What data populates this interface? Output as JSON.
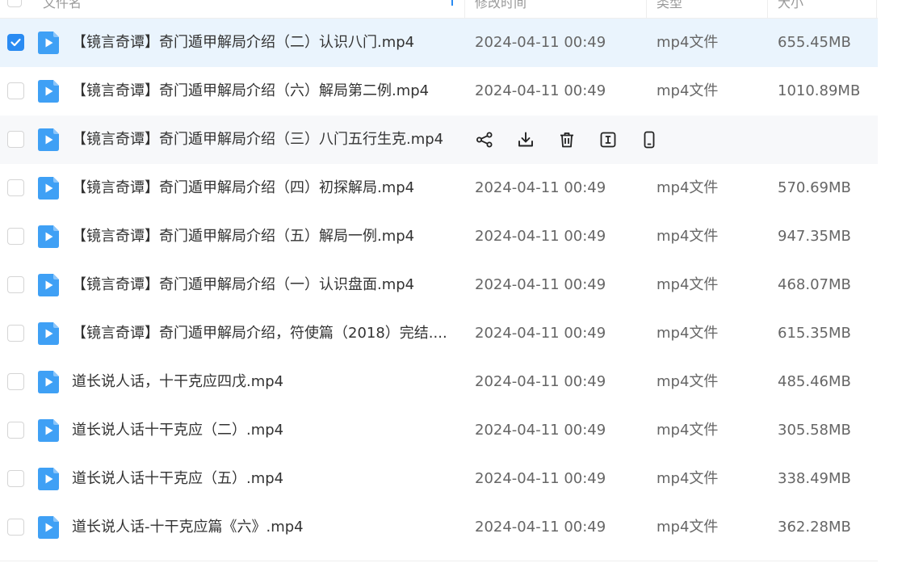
{
  "header": {
    "name": "文件名",
    "modified": "修改时间",
    "type": "类型",
    "size": "大小"
  },
  "files": [
    {
      "name": "【镜言奇谭】奇门遁甲解局介绍（二）认识八门.mp4",
      "date": "2024-04-11 00:49",
      "type": "mp4文件",
      "size": "655.45MB",
      "selected": true
    },
    {
      "name": "【镜言奇谭】奇门遁甲解局介绍（六）解局第二例.mp4",
      "date": "2024-04-11 00:49",
      "type": "mp4文件",
      "size": "1010.89MB"
    },
    {
      "name": "【镜言奇谭】奇门遁甲解局介绍（三）八门五行生克.mp4",
      "date": "",
      "type": "",
      "size": "",
      "hover": true
    },
    {
      "name": "【镜言奇谭】奇门遁甲解局介绍（四）初探解局.mp4",
      "date": "2024-04-11 00:49",
      "type": "mp4文件",
      "size": "570.69MB"
    },
    {
      "name": "【镜言奇谭】奇门遁甲解局介绍（五）解局一例.mp4",
      "date": "2024-04-11 00:49",
      "type": "mp4文件",
      "size": "947.35MB"
    },
    {
      "name": "【镜言奇谭】奇门遁甲解局介绍（一）认识盘面.mp4",
      "date": "2024-04-11 00:49",
      "type": "mp4文件",
      "size": "468.07MB"
    },
    {
      "name": "【镜言奇谭】奇门遁甲解局介绍，符使篇（2018）完结....",
      "date": "2024-04-11 00:49",
      "type": "mp4文件",
      "size": "615.35MB"
    },
    {
      "name": "道长说人话，十干克应四戊.mp4",
      "date": "2024-04-11 00:49",
      "type": "mp4文件",
      "size": "485.46MB"
    },
    {
      "name": "道长说人话十干克应（二）.mp4",
      "date": "2024-04-11 00:49",
      "type": "mp4文件",
      "size": "305.58MB"
    },
    {
      "name": "道长说人话十干克应（五）.mp4",
      "date": "2024-04-11 00:49",
      "type": "mp4文件",
      "size": "338.49MB"
    },
    {
      "name": "道长说人话-十干克应篇《六》.mp4",
      "date": "2024-04-11 00:49",
      "type": "mp4文件",
      "size": "362.28MB"
    }
  ],
  "hover_actions": [
    "share-icon",
    "download-icon",
    "delete-icon",
    "rename-icon",
    "phone-icon"
  ],
  "colors": {
    "accent": "#2a8bf2",
    "file_icon": "#3fa0f5",
    "selected_row": "#eaf4fd",
    "hover_row": "#f7f8fa"
  }
}
